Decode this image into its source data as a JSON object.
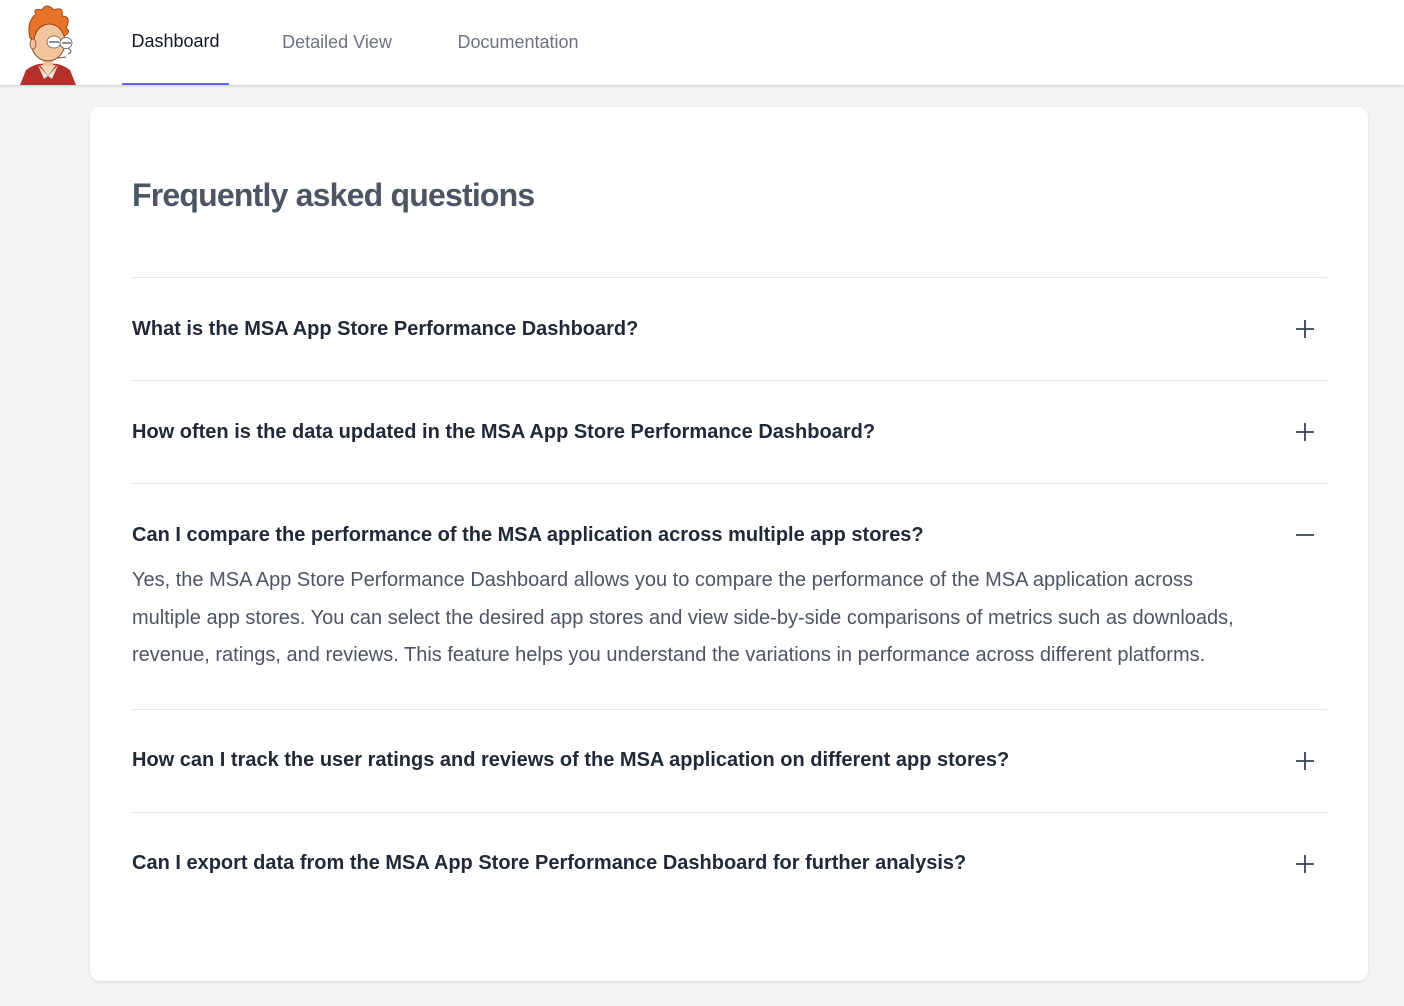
{
  "nav": {
    "logo_icon": "cartoon-avatar-icon",
    "tabs": [
      {
        "label": "Dashboard",
        "active": true
      },
      {
        "label": "Detailed View",
        "active": false
      },
      {
        "label": "Documentation",
        "active": false
      }
    ]
  },
  "faq": {
    "title": "Frequently asked questions",
    "items": [
      {
        "question": "What is the MSA App Store Performance Dashboard?",
        "expanded": false,
        "toggle_icon": "plus-icon"
      },
      {
        "question": "How often is the data updated in the MSA App Store Performance Dashboard?",
        "expanded": false,
        "toggle_icon": "plus-icon"
      },
      {
        "question": "Can I compare the performance of the MSA application across multiple app stores?",
        "expanded": true,
        "toggle_icon": "minus-icon",
        "answer": "Yes, the MSA App Store Performance Dashboard allows you to compare the performance of the MSA application across multiple app stores. You can select the desired app stores and view side-by-side comparisons of metrics such as downloads, revenue, ratings, and reviews. This feature helps you understand the variations in performance across different platforms."
      },
      {
        "question": "How can I track the user ratings and reviews of the MSA application on different app stores?",
        "expanded": false,
        "toggle_icon": "plus-icon"
      },
      {
        "question": "Can I export data from the MSA App Store Performance Dashboard for further analysis?",
        "expanded": false,
        "toggle_icon": "plus-icon"
      }
    ]
  },
  "colors": {
    "accent": "#6366f1",
    "page_bg": "#f3f4f6",
    "card_bg": "#ffffff",
    "text_dark": "#1f2937",
    "text_muted": "#6b7280"
  }
}
